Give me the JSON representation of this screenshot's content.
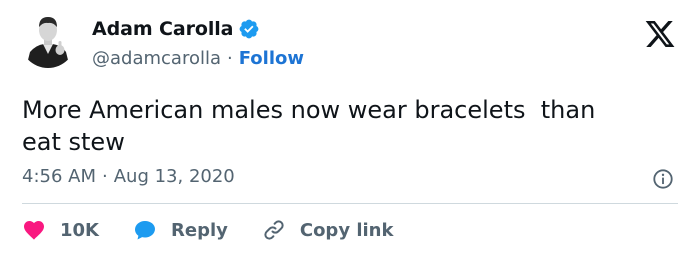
{
  "author": {
    "display_name": "Adam Carolla",
    "handle": "@adamcarolla",
    "separator": "·",
    "follow_label": "Follow"
  },
  "tweet": {
    "text": "More American males now wear bracelets  than\neat stew",
    "time": "4:56 AM",
    "separator": "·",
    "date": "Aug 13, 2020"
  },
  "actions": {
    "likes_count": "10K",
    "reply_label": "Reply",
    "copy_link_label": "Copy link"
  },
  "colors": {
    "verified": "#1d9bf0",
    "follow": "#1d74d4",
    "heart": "#f91880",
    "reply_bubble": "#1d9bf0",
    "secondary_text": "#536471"
  },
  "icons": [
    "verified-badge-icon",
    "x-logo-icon",
    "info-icon",
    "heart-icon",
    "reply-bubble-icon",
    "link-icon"
  ]
}
